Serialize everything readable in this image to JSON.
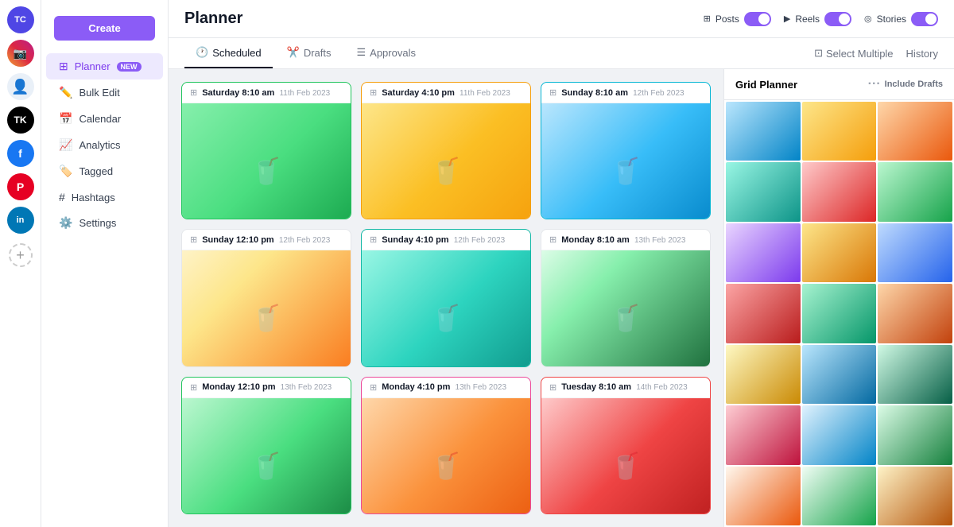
{
  "app": {
    "user_initials": "TC"
  },
  "social_icons": [
    {
      "name": "instagram",
      "icon": "📷",
      "class": "ig"
    },
    {
      "name": "facebook-profile",
      "icon": "👤",
      "class": "fb-placeholder"
    },
    {
      "name": "tiktok",
      "icon": "♪",
      "class": "tk"
    },
    {
      "name": "facebook",
      "icon": "f",
      "class": "fb2"
    },
    {
      "name": "pinterest",
      "icon": "P",
      "class": "pi"
    },
    {
      "name": "linkedin",
      "icon": "in",
      "class": "li"
    }
  ],
  "sidebar": {
    "create_label": "Create",
    "items": [
      {
        "id": "planner",
        "icon": "⊞",
        "label": "Planner",
        "badge": "NEW",
        "active": true
      },
      {
        "id": "bulk-edit",
        "icon": "✏️",
        "label": "Bulk Edit"
      },
      {
        "id": "calendar",
        "icon": "📅",
        "label": "Calendar"
      },
      {
        "id": "analytics",
        "icon": "📈",
        "label": "Analytics"
      },
      {
        "id": "tagged",
        "icon": "🏷️",
        "label": "Tagged"
      },
      {
        "id": "hashtags",
        "icon": "#",
        "label": "Hashtags"
      },
      {
        "id": "settings",
        "icon": "⚙️",
        "label": "Settings"
      }
    ]
  },
  "header": {
    "title": "Planner",
    "toggles": [
      {
        "label": "Posts",
        "enabled": true
      },
      {
        "label": "Reels",
        "enabled": true
      },
      {
        "label": "Stories",
        "enabled": true
      }
    ]
  },
  "tabs": {
    "items": [
      {
        "id": "scheduled",
        "icon": "🕐",
        "label": "Scheduled",
        "active": true
      },
      {
        "id": "drafts",
        "icon": "✂️",
        "label": "Drafts"
      },
      {
        "id": "approvals",
        "icon": "☰",
        "label": "Approvals"
      }
    ],
    "actions": [
      {
        "id": "select-multiple",
        "icon": "⊡",
        "label": "Select Multiple"
      },
      {
        "id": "history",
        "label": "History"
      }
    ]
  },
  "posts": [
    {
      "id": 1,
      "day": "Saturday",
      "time": "8:10 am",
      "date": "11th Feb 2023",
      "img_class": "img-1",
      "border": "green-border"
    },
    {
      "id": 2,
      "day": "Saturday",
      "time": "4:10 pm",
      "date": "11th Feb 2023",
      "img_class": "img-2",
      "border": "yellow-border"
    },
    {
      "id": 3,
      "day": "Sunday",
      "time": "8:10 am",
      "date": "12th Feb 2023",
      "img_class": "img-3",
      "border": "blue-border"
    },
    {
      "id": 4,
      "day": "Sunday",
      "time": "12:10 pm",
      "date": "12th Feb 2023",
      "img_class": "img-4",
      "border": ""
    },
    {
      "id": 5,
      "day": "Sunday",
      "time": "4:10 pm",
      "date": "12th Feb 2023",
      "img_class": "img-5",
      "border": "teal-border"
    },
    {
      "id": 6,
      "day": "Monday",
      "time": "8:10 am",
      "date": "13th Feb 2023",
      "img_class": "img-6",
      "border": ""
    },
    {
      "id": 7,
      "day": "Monday",
      "time": "12:10 pm",
      "date": "13th Feb 2023",
      "img_class": "img-7",
      "border": "green-border"
    },
    {
      "id": 8,
      "day": "Monday",
      "time": "4:10 pm",
      "date": "13th Feb 2023",
      "img_class": "img-8",
      "border": "pink-border"
    },
    {
      "id": 9,
      "day": "Tuesday",
      "time": "8:10 am",
      "date": "14th Feb 2023",
      "img_class": "img-9",
      "border": "red-border"
    }
  ],
  "grid_planner": {
    "title": "Grid Planner",
    "include_drafts_label": "Include Drafts",
    "mosaic_colors": [
      "m1",
      "m2",
      "m3",
      "m4",
      "m5",
      "m6",
      "m7",
      "m8",
      "m9",
      "m10",
      "m11",
      "m12",
      "m13",
      "m14",
      "m15",
      "m16",
      "m17",
      "m18",
      "m19",
      "m20",
      "m21"
    ]
  }
}
